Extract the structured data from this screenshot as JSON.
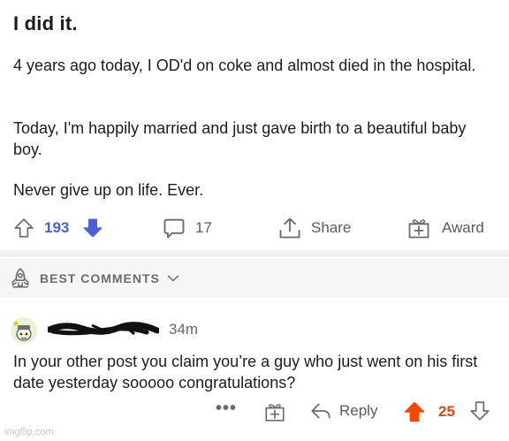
{
  "post": {
    "title": "I did it.",
    "paragraph1": "4 years ago today, I OD'd on coke and almost died in the hospital.",
    "paragraph2": "Today, I'm happily married and just gave birth to a beautiful baby boy.",
    "paragraph3": "Never give up on life. Ever.",
    "upvotes": "193",
    "comments": "17",
    "share_label": "Share",
    "award_label": "Award"
  },
  "comments_header": {
    "label": "BEST COMMENTS"
  },
  "comment": {
    "time": "34m",
    "text": "In your other post you claim you’re a guy who just went on his first date yesterday sooooo congratulations?",
    "more": "•••",
    "reply_label": "Reply",
    "score": "25"
  },
  "watermark": "imgflip.com",
  "colors": {
    "upvote_blue": "#4a5fd8",
    "upvote_orange": "#ff4500",
    "score_orange": "#d9480f",
    "text_gray": "#5b5b5b",
    "separator": "#f2f2f2"
  },
  "icons": {
    "upvote": "arrow-up-outline-icon",
    "downvote": "arrow-down-filled-icon",
    "comments": "speech-bubble-icon",
    "share": "share-icon",
    "award": "gift-icon",
    "rocket": "rocket-icon",
    "chevron": "chevron-down-icon",
    "reply": "reply-arrow-icon",
    "comment_upvote": "arrow-up-filled-icon",
    "comment_downvote": "arrow-down-outline-icon"
  }
}
